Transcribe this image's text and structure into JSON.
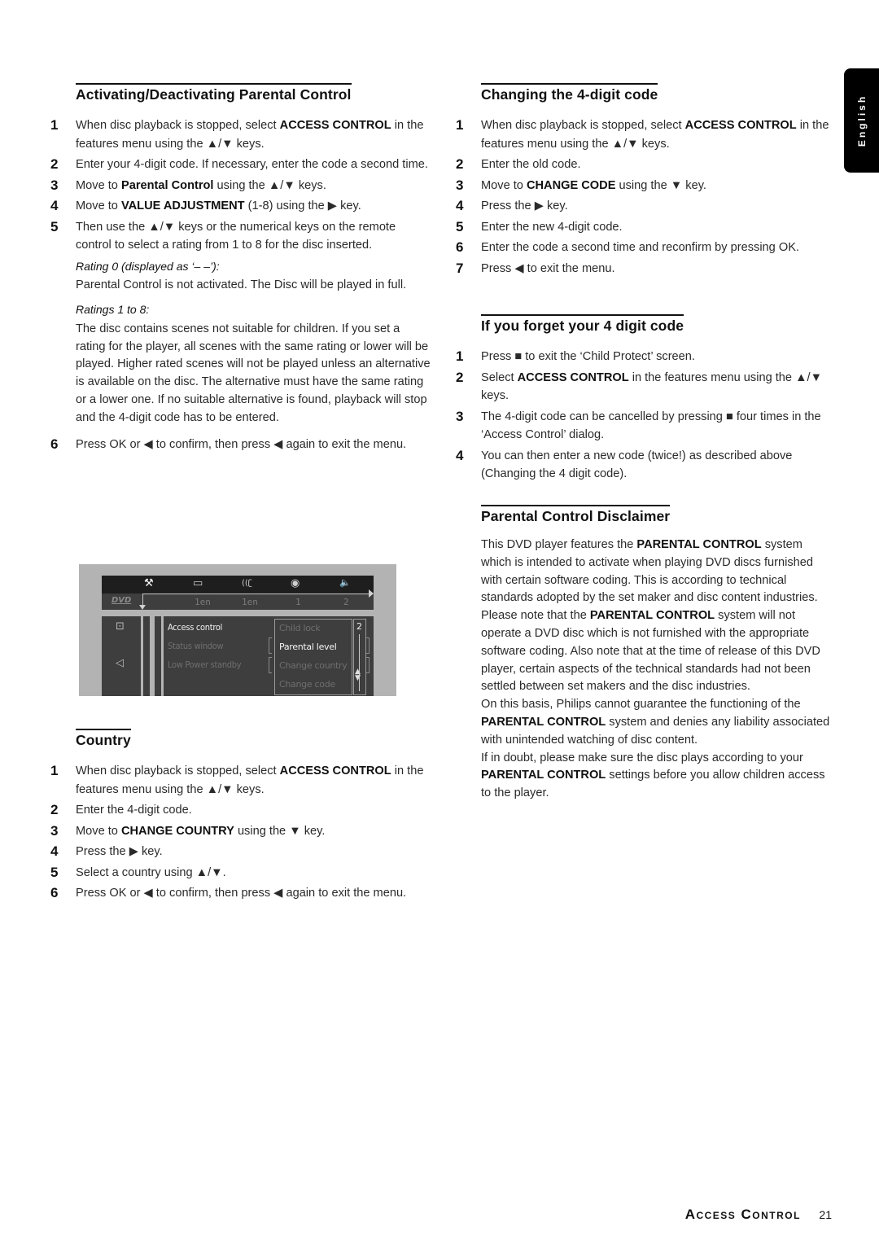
{
  "side_tab": {
    "label": "English"
  },
  "footer": {
    "section_title": "Access Control",
    "page_number": "21"
  },
  "sections": {
    "activating": {
      "title": "Activating/Deactivating Parental Control",
      "steps": [
        {
          "num": "1",
          "pre": "When disc playback is stopped, select ",
          "bold": "ACCESS CONTROL",
          "post": " in the features menu using the ▲/▼ keys."
        },
        {
          "num": "2",
          "pre": "Enter your 4-digit code. If necessary, enter the code a second time.",
          "bold": "",
          "post": ""
        },
        {
          "num": "3",
          "pre": "Move to ",
          "bold": "Parental Control",
          "post": " using the ▲/▼ keys."
        },
        {
          "num": "4",
          "pre": "Move to ",
          "bold": "VALUE ADJUSTMENT",
          "post": " (1-8) using the ▶ key."
        },
        {
          "num": "5",
          "pre": "Then use the ▲/▼ keys or the numerical keys on the remote control to select a rating from 1 to 8 for the disc inserted.",
          "bold": "",
          "post": ""
        }
      ],
      "rating0_label": "Rating 0 (displayed as ‘– –’):",
      "rating0_text": "Parental Control is not activated. The Disc will be played in full.",
      "ratings18_label": "Ratings 1 to 8:",
      "ratings18_text": "The disc contains scenes not suitable for children. If you set a rating for the player, all scenes with the same rating or lower will be played. Higher rated scenes will not be played unless an alternative is available on the disc. The alternative must have the same rating or a lower one. If no suitable alternative is found, playback will stop and the 4-digit code has to be entered.",
      "step6": {
        "num": "6",
        "text": "Press OK or ◀ to confirm, then press ◀ again to exit the menu."
      }
    },
    "osd": {
      "icons": [
        "tools-icon",
        "subtitle-icon",
        "audio-icon",
        "angle-icon",
        "speaker-icon"
      ],
      "icon_glyphs": [
        "⚒",
        "▭",
        "((ʗ",
        "◉",
        "🔈"
      ],
      "values": [
        "1en",
        "1en",
        "1",
        "2"
      ],
      "disc_logo": "DVD",
      "menu_items": [
        {
          "label": "Access control",
          "active": true
        },
        {
          "label": "Status window",
          "active": false
        },
        {
          "label": "Low Power standby",
          "active": false
        }
      ],
      "submenu_items": [
        {
          "label": "Child lock",
          "active": false
        },
        {
          "label": "Parental level",
          "active": true
        },
        {
          "label": "Change country",
          "active": false
        },
        {
          "label": "Change code",
          "active": false
        }
      ],
      "level_value": "2"
    },
    "country": {
      "title": "Country",
      "steps": [
        {
          "num": "1",
          "pre": "When disc playback is stopped, select ",
          "bold": "ACCESS CONTROL",
          "post": " in the features menu using the ▲/▼ keys."
        },
        {
          "num": "2",
          "pre": "Enter the 4-digit code.",
          "bold": "",
          "post": ""
        },
        {
          "num": "3",
          "pre": "Move to ",
          "bold": "CHANGE COUNTRY",
          "post": " using the ▼ key."
        },
        {
          "num": "4",
          "pre": "Press the ▶ key.",
          "bold": "",
          "post": ""
        },
        {
          "num": "5",
          "pre": "Select a country using ▲/▼.",
          "bold": "",
          "post": ""
        },
        {
          "num": "6",
          "pre": "Press OK or ◀ to confirm, then press ◀ again to exit the menu.",
          "bold": "",
          "post": ""
        }
      ]
    },
    "changing_code": {
      "title": "Changing the 4-digit code",
      "steps": [
        {
          "num": "1",
          "pre": "When disc playback is stopped, select ",
          "bold": "ACCESS CONTROL",
          "post": " in the features menu using the ▲/▼ keys."
        },
        {
          "num": "2",
          "pre": "Enter the old code.",
          "bold": "",
          "post": ""
        },
        {
          "num": "3",
          "pre": "Move to ",
          "bold": "CHANGE CODE",
          "post": " using the ▼ key."
        },
        {
          "num": "4",
          "pre": "Press the ▶ key.",
          "bold": "",
          "post": ""
        },
        {
          "num": "5",
          "pre": "Enter the new 4-digit code.",
          "bold": "",
          "post": ""
        },
        {
          "num": "6",
          "pre": "Enter the code a second time and reconfirm by pressing OK.",
          "bold": "",
          "post": ""
        },
        {
          "num": "7",
          "pre": "Press ◀ to exit the menu.",
          "bold": "",
          "post": ""
        }
      ]
    },
    "forget_code": {
      "title": "If you forget your 4 digit code",
      "steps": [
        {
          "num": "1",
          "pre": "Press ■ to exit the ‘Child Protect’ screen.",
          "bold": "",
          "post": ""
        },
        {
          "num": "2",
          "pre": "Select ",
          "bold": "ACCESS CONTROL",
          "post": " in the features menu using the ▲/▼ keys."
        },
        {
          "num": "3",
          "pre": "The 4-digit code can be cancelled by pressing ■ four times in the ‘Access Control’ dialog.",
          "bold": "",
          "post": ""
        },
        {
          "num": "4",
          "pre": "You can then enter a new code (twice!) as described above (Changing the 4 digit code).",
          "bold": "",
          "post": ""
        }
      ]
    },
    "disclaimer": {
      "title": "Parental Control Disclaimer",
      "paragraphs": [
        {
          "pre": "This DVD player features the ",
          "bold": "PARENTAL CONTROL",
          "post": " system which is intended to activate when playing DVD discs furnished with certain software coding. This is according to technical standards adopted by the set maker and disc content industries."
        },
        {
          "pre": "Please note that the ",
          "bold": "PARENTAL CONTROL",
          "post": " system will not operate a DVD disc which is not furnished with the appropriate software coding. Also note that at the time of release of this DVD player, certain aspects of the technical standards had not been settled between set makers and the disc industries."
        },
        {
          "pre": "On this basis, Philips cannot guarantee the functioning of the ",
          "bold": "PARENTAL CONTROL",
          "post": " system and denies any liability associated with unintended watching of disc content."
        },
        {
          "pre": "If in doubt, please make sure the disc plays according to your ",
          "bold": "PARENTAL CONTROL",
          "post": " settings before you allow children access to the player."
        }
      ]
    }
  }
}
